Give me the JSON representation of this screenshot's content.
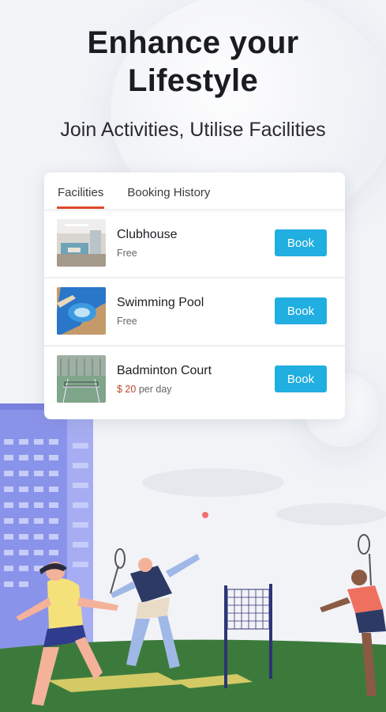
{
  "hero": {
    "title_line1": "Enhance your",
    "title_line2": "Lifestyle",
    "subtitle": "Join Activities, Utilise Facilities"
  },
  "tabs": [
    {
      "label": "Facilities",
      "active": true
    },
    {
      "label": "Booking History",
      "active": false
    }
  ],
  "facilities": [
    {
      "name": "Clubhouse",
      "price": "Free",
      "button": "Book",
      "icon": "clubhouse-photo"
    },
    {
      "name": "Swimming Pool",
      "price": "Free",
      "button": "Book",
      "icon": "pool-photo"
    },
    {
      "name": "Badminton Court",
      "price_amount": "$ 20",
      "price_unit": "per day",
      "button": "Book",
      "icon": "court-photo"
    }
  ],
  "colors": {
    "accent": "#e04a2a",
    "button": "#21aee0",
    "background": "#f2f3f7",
    "building": "#8a93ea",
    "grass": "#3c7a3b"
  }
}
